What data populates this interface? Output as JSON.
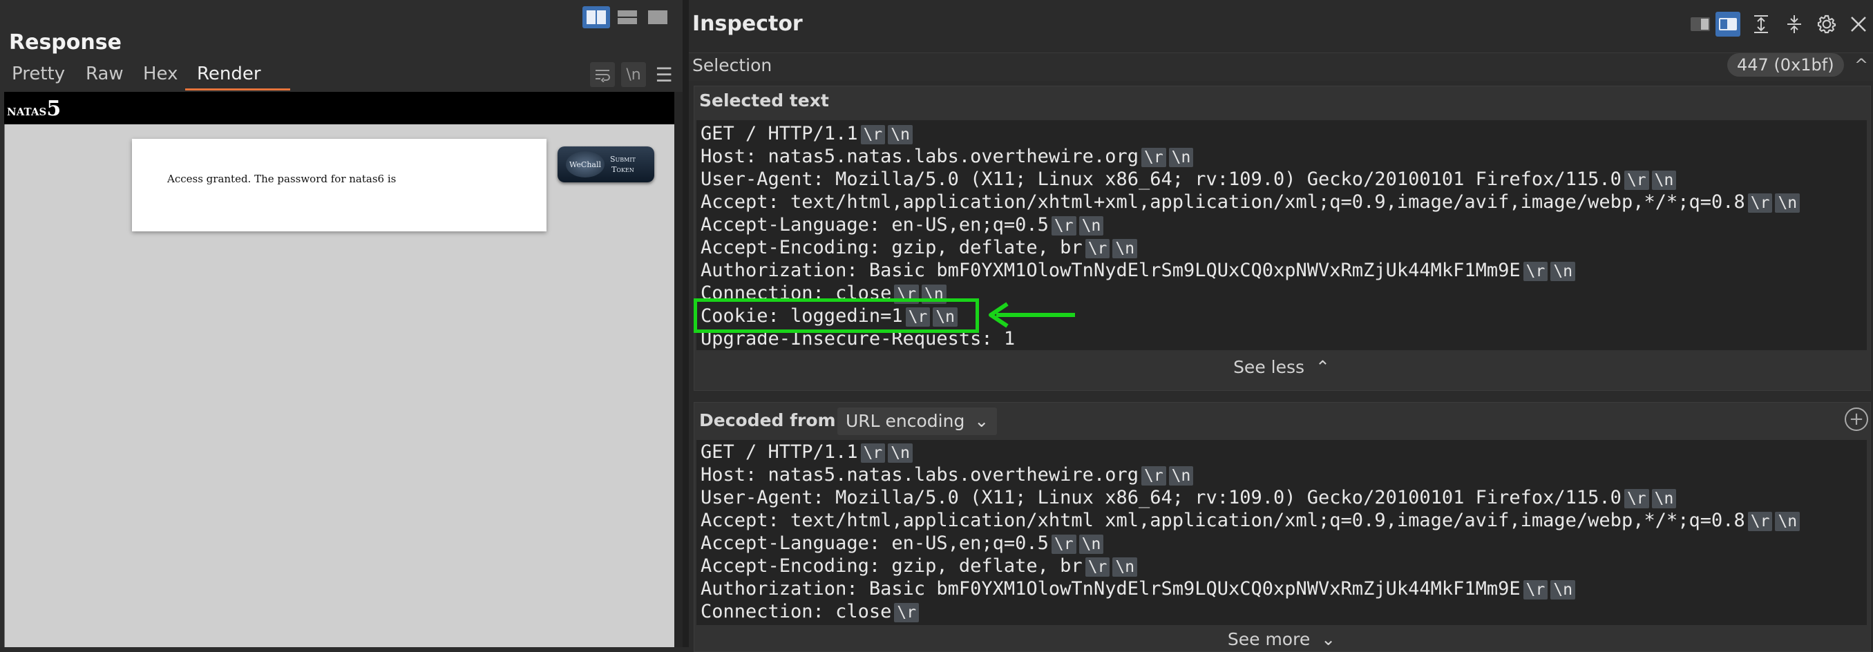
{
  "response_panel": {
    "title": "Response",
    "tabs": [
      {
        "label": "Pretty"
      },
      {
        "label": "Raw"
      },
      {
        "label": "Hex"
      },
      {
        "label": "Render"
      }
    ],
    "active_tab": "Render",
    "newline_toggle_label": "\\n",
    "render": {
      "site_title_prefix": "natas",
      "site_title_number": "5",
      "message": "Access granted. The password for natas6 is",
      "badge_logo": "WeChall",
      "badge_line1": "Submit",
      "badge_line2": "Token"
    }
  },
  "inspector": {
    "title": "Inspector",
    "selection_label": "Selection",
    "selection_value": "447 (0x1bf)",
    "selected_text": {
      "heading": "Selected text",
      "lines": [
        {
          "text": "GET / HTTP/1.1",
          "esc": [
            "\\r",
            "\\n"
          ]
        },
        {
          "text": "Host: natas5.natas.labs.overthewire.org",
          "esc": [
            "\\r",
            "\\n"
          ]
        },
        {
          "text": "User-Agent: Mozilla/5.0 (X11; Linux x86_64; rv:109.0) Gecko/20100101 Firefox/115.0",
          "esc": [
            "\\r",
            "\\n"
          ]
        },
        {
          "text": "Accept: text/html,application/xhtml+xml,application/xml;q=0.9,image/avif,image/webp,*/*;q=0.8",
          "esc": [
            "\\r",
            "\\n"
          ]
        },
        {
          "text": "Accept-Language: en-US,en;q=0.5",
          "esc": [
            "\\r",
            "\\n"
          ]
        },
        {
          "text": "Accept-Encoding: gzip, deflate, br",
          "esc": [
            "\\r",
            "\\n"
          ]
        },
        {
          "text": "Authorization: Basic bmF0YXM1OlowTnNydElrSm9LQUxCQ0xpNWVxRmZjUk44MkF1Mm9E",
          "esc": [
            "\\r",
            "\\n"
          ]
        },
        {
          "text": "Connection: close",
          "esc": [
            "\\r",
            "\\n"
          ]
        },
        {
          "text": "Cookie: loggedin=1",
          "esc": [
            "\\r",
            "\\n"
          ]
        },
        {
          "text": "Upgrade-Insecure-Requests: 1",
          "esc": []
        }
      ],
      "toggle_label": "See less"
    },
    "decoded": {
      "heading": "Decoded from:",
      "encoding": "URL encoding",
      "lines": [
        {
          "text": "GET / HTTP/1.1",
          "esc": [
            "\\r",
            "\\n"
          ]
        },
        {
          "text": "Host: natas5.natas.labs.overthewire.org",
          "esc": [
            "\\r",
            "\\n"
          ]
        },
        {
          "text": "User-Agent: Mozilla/5.0 (X11; Linux x86_64; rv:109.0) Gecko/20100101 Firefox/115.0",
          "esc": [
            "\\r",
            "\\n"
          ]
        },
        {
          "text": "Accept: text/html,application/xhtml xml,application/xml;q=0.9,image/avif,image/webp,*/*;q=0.8",
          "esc": [
            "\\r",
            "\\n"
          ]
        },
        {
          "text": "Accept-Language: en-US,en;q=0.5",
          "esc": [
            "\\r",
            "\\n"
          ]
        },
        {
          "text": "Accept-Encoding: gzip, deflate, br",
          "esc": [
            "\\r",
            "\\n"
          ]
        },
        {
          "text": "Authorization: Basic bmF0YXM1OlowTnNydElrSm9LQUxCQ0xpNWVxRmZjUk44MkF1Mm9E",
          "esc": [
            "\\r",
            "\\n"
          ]
        },
        {
          "text": "Connection: close",
          "esc": [
            "\\r"
          ]
        }
      ],
      "toggle_label": "See more"
    }
  },
  "colors": {
    "accent_blue": "#3b6fb3",
    "tab_underline": "#e8743b",
    "annotation_green": "#19d419"
  }
}
